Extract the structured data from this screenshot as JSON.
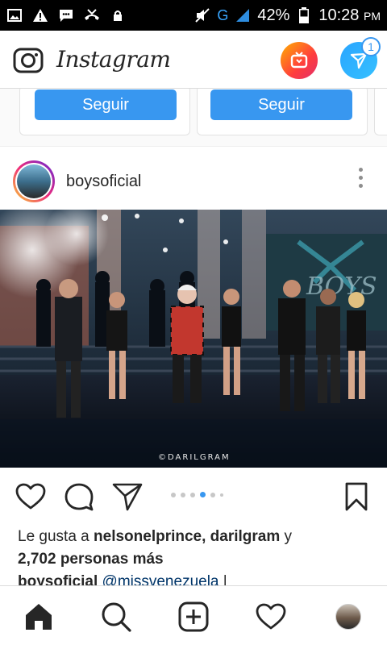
{
  "status": {
    "battery": "42%",
    "time": "10:28",
    "ampm": "PM",
    "network": "G"
  },
  "header": {
    "title": "Instagram",
    "dm_badge": "1"
  },
  "suggestions": {
    "follow_label": "Seguir"
  },
  "post": {
    "username": "boysoficial",
    "watermark": "©DARILGRAM",
    "likes_prefix": "Le gusta a ",
    "likers": "nelsonelprince, darilgram",
    "likes_join": " y",
    "likes_count": "2,702 personas más",
    "caption_user": "boysoficial",
    "caption_mention": "@missvenezuela",
    "caption_tail": " |"
  },
  "colors": {
    "accent": "#3897f0",
    "text": "#262626",
    "statusbar": "#000000"
  },
  "icons": [
    "home-icon",
    "search-icon",
    "add-icon",
    "heart-icon",
    "profile-avatar",
    "camera-icon",
    "igtv-icon",
    "direct-icon",
    "comment-icon",
    "share-icon",
    "bookmark-icon"
  ]
}
